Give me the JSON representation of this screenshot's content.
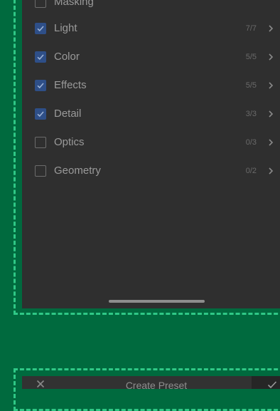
{
  "colors": {
    "background": "#006a3e",
    "dashed_border": "#2fc886",
    "panel": "#2f2f2f",
    "checkbox_checked": "#2e4f88",
    "text": "#9a9a9a"
  },
  "settings": {
    "items": [
      {
        "label": "Masking",
        "checked": false,
        "count": ""
      },
      {
        "label": "Light",
        "checked": true,
        "count": "7/7"
      },
      {
        "label": "Color",
        "checked": true,
        "count": "5/5"
      },
      {
        "label": "Effects",
        "checked": true,
        "count": "5/5"
      },
      {
        "label": "Detail",
        "checked": true,
        "count": "3/3"
      },
      {
        "label": "Optics",
        "checked": false,
        "count": "0/3"
      },
      {
        "label": "Geometry",
        "checked": false,
        "count": "0/2"
      }
    ]
  },
  "bottom_bar": {
    "title": "Create Preset",
    "close_icon": "close-icon",
    "confirm_icon": "checkmark-icon"
  }
}
